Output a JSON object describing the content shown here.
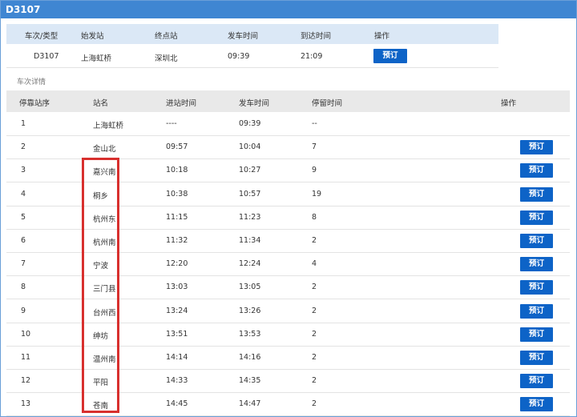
{
  "title": "D3107",
  "summary": {
    "headers": [
      "车次/类型",
      "始发站",
      "终点站",
      "发车时间",
      "到达时间",
      "操作"
    ],
    "values": [
      "D3107",
      "上海虹桥",
      "深圳北",
      "09:39",
      "21:09"
    ],
    "book_label": "预订"
  },
  "section_label": "车次详情",
  "detail": {
    "headers": [
      "停靠站序",
      "站名",
      "进站时间",
      "发车时间",
      "停留时间",
      "操作"
    ],
    "book_label": "预订",
    "rows": [
      {
        "seq": "1",
        "station": "上海虹桥",
        "arrive": "----",
        "depart": "09:39",
        "stay": "--",
        "bookable": false
      },
      {
        "seq": "2",
        "station": "金山北",
        "arrive": "09:57",
        "depart": "10:04",
        "stay": "7",
        "bookable": true
      },
      {
        "seq": "3",
        "station": "嘉兴南",
        "arrive": "10:18",
        "depart": "10:27",
        "stay": "9",
        "bookable": true
      },
      {
        "seq": "4",
        "station": "桐乡",
        "arrive": "10:38",
        "depart": "10:57",
        "stay": "19",
        "bookable": true
      },
      {
        "seq": "5",
        "station": "杭州东",
        "arrive": "11:15",
        "depart": "11:23",
        "stay": "8",
        "bookable": true
      },
      {
        "seq": "6",
        "station": "杭州南",
        "arrive": "11:32",
        "depart": "11:34",
        "stay": "2",
        "bookable": true
      },
      {
        "seq": "7",
        "station": "宁波",
        "arrive": "12:20",
        "depart": "12:24",
        "stay": "4",
        "bookable": true
      },
      {
        "seq": "8",
        "station": "三门县",
        "arrive": "13:03",
        "depart": "13:05",
        "stay": "2",
        "bookable": true
      },
      {
        "seq": "9",
        "station": "台州西",
        "arrive": "13:24",
        "depart": "13:26",
        "stay": "2",
        "bookable": true
      },
      {
        "seq": "10",
        "station": "绅坊",
        "arrive": "13:51",
        "depart": "13:53",
        "stay": "2",
        "bookable": true
      },
      {
        "seq": "11",
        "station": "温州南",
        "arrive": "14:14",
        "depart": "14:16",
        "stay": "2",
        "bookable": true
      },
      {
        "seq": "12",
        "station": "平阳",
        "arrive": "14:33",
        "depart": "14:35",
        "stay": "2",
        "bookable": true
      },
      {
        "seq": "13",
        "station": "苍南",
        "arrive": "14:45",
        "depart": "14:47",
        "stay": "2",
        "bookable": true
      }
    ]
  },
  "colors": {
    "titlebar": "#3f86d2",
    "button": "#0d63c7",
    "highlight_box": "#d8302e"
  }
}
